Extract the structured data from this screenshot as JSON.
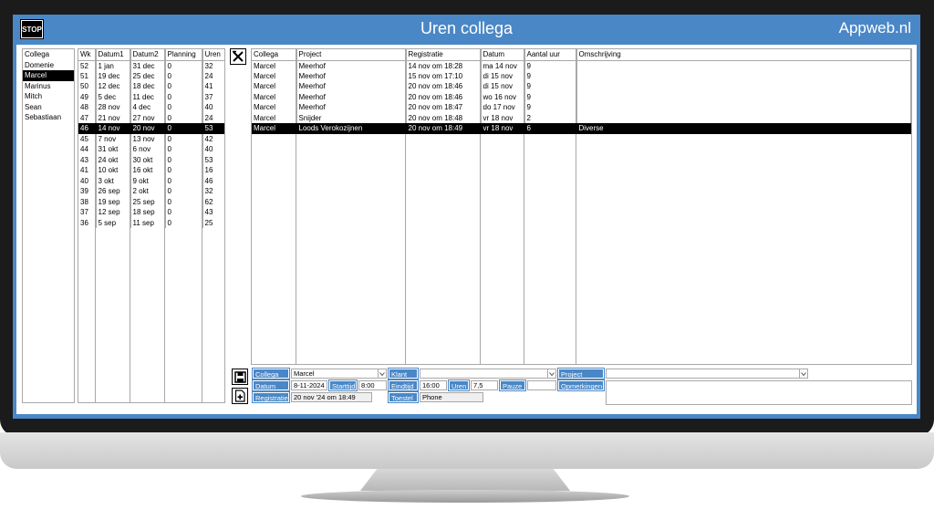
{
  "window": {
    "title": "Uren collega",
    "brand": "Appweb.nl",
    "stop_label": "STOP"
  },
  "colleagues": {
    "header": "Collega",
    "items": [
      "Domenie",
      "Marcel",
      "Marinus",
      "Mitch",
      "Sean",
      "Sebastiaan"
    ],
    "selected_index": 1
  },
  "weeks": {
    "headers": [
      "Wk",
      "Datum1",
      "Datum2",
      "Planning",
      "Uren"
    ],
    "rows": [
      [
        "52",
        "1 jan",
        "31 dec",
        "0",
        "32"
      ],
      [
        "51",
        "19 dec",
        "25 dec",
        "0",
        "24"
      ],
      [
        "50",
        "12 dec",
        "18 dec",
        "0",
        "41"
      ],
      [
        "49",
        "5 dec",
        "11 dec",
        "0",
        "37"
      ],
      [
        "48",
        "28 nov",
        "4 dec",
        "0",
        "40"
      ],
      [
        "47",
        "21 nov",
        "27 nov",
        "0",
        "24"
      ],
      [
        "46",
        "14 nov",
        "20 nov",
        "0",
        "53"
      ],
      [
        "45",
        "7 nov",
        "13 nov",
        "0",
        "42"
      ],
      [
        "44",
        "31 okt",
        "6 nov",
        "0",
        "40"
      ],
      [
        "43",
        "24 okt",
        "30 okt",
        "0",
        "53"
      ],
      [
        "41",
        "10 okt",
        "16 okt",
        "0",
        "16"
      ],
      [
        "40",
        "3 okt",
        "9 okt",
        "0",
        "46"
      ],
      [
        "39",
        "26 sep",
        "2 okt",
        "0",
        "32"
      ],
      [
        "38",
        "19 sep",
        "25 sep",
        "0",
        "62"
      ],
      [
        "37",
        "12 sep",
        "18 sep",
        "0",
        "43"
      ],
      [
        "36",
        "5 sep",
        "11 sep",
        "0",
        "25"
      ]
    ],
    "selected_index": 6
  },
  "entries": {
    "headers": [
      "Collega",
      "Project",
      "Registratie",
      "Datum",
      "Aantal uur",
      "Omschrijving"
    ],
    "rows": [
      [
        "Marcel",
        "Meerhof",
        "14 nov om 18:28",
        "ma 14 nov",
        "9",
        ""
      ],
      [
        "Marcel",
        "Meerhof",
        "15 nov om 17:10",
        "di 15 nov",
        "9",
        ""
      ],
      [
        "Marcel",
        "Meerhof",
        "20 nov om 18:46",
        "di 15 nov",
        "9",
        ""
      ],
      [
        "Marcel",
        "Meerhof",
        "20 nov om 18:46",
        "wo 16 nov",
        "9",
        ""
      ],
      [
        "Marcel",
        "Meerhof",
        "20 nov om 18:47",
        "do 17 nov",
        "9",
        ""
      ],
      [
        "Marcel",
        "Snijder",
        "20 nov om 18:48",
        "vr 18 nov",
        "2",
        ""
      ],
      [
        "Marcel",
        "Loods Verokozijnen",
        "20 nov om 18:49",
        "vr 18 nov",
        "6",
        "Diverse"
      ]
    ],
    "selected_index": 6
  },
  "form": {
    "collega_label": "Collega",
    "collega_value": "Marcel",
    "klant_label": "Klant",
    "klant_value": "",
    "project_label": "Project",
    "project_value": "",
    "datum_label": "Datum",
    "datum_value": "8-11-2024",
    "starttijd_label": "Starttijd",
    "starttijd_value": "8:00",
    "eindtijd_label": "Eindtijd",
    "eindtijd_value": "16:00",
    "uren_label": "Uren",
    "uren_value": "7,5",
    "pauze_label": "Pauze",
    "pauze_value": "",
    "opmerkingen_label": "Opmerkingen",
    "registratie_label": "Registratie",
    "registratie_value": "20 nov '24 om 18:49",
    "toestel_label": "Toestel",
    "toestel_value": "Phone"
  },
  "icons": {
    "delete": "delete-icon",
    "save": "save-icon",
    "new": "new-document-icon",
    "dropdown": "chevron-down-icon"
  }
}
